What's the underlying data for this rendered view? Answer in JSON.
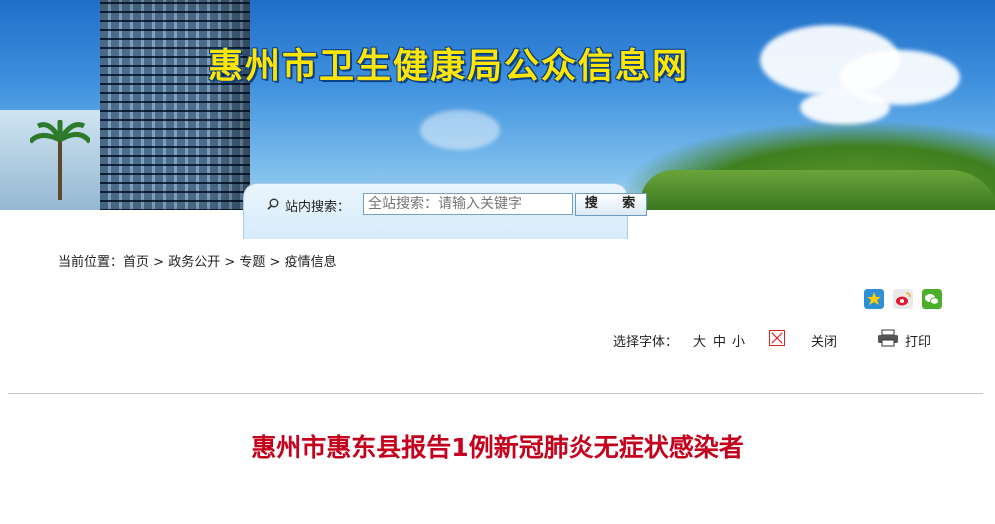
{
  "site": {
    "title": "惠州市卫生健康局公众信息网"
  },
  "search": {
    "label": "站内搜索：",
    "placeholder": "全站搜索：请输入关键字",
    "button_label": "搜  索"
  },
  "breadcrumb": {
    "prefix": "当前位置：",
    "items": [
      "首页",
      "政务公开",
      "专题",
      "疫情信息"
    ],
    "separator": " > "
  },
  "share": {
    "icons": [
      "qzone-icon",
      "weibo-icon",
      "wechat-icon"
    ]
  },
  "tools": {
    "font_label": "选择字体：",
    "font_large": "大",
    "font_medium": "中",
    "font_small": "小",
    "close_label": "关闭",
    "print_label": "打印"
  },
  "article": {
    "title": "惠州市惠东县报告1例新冠肺炎无症状感染者"
  },
  "colors": {
    "title_red": "#c5001d",
    "banner_blue": "#3f91de",
    "title_yellow": "#ffe600"
  }
}
